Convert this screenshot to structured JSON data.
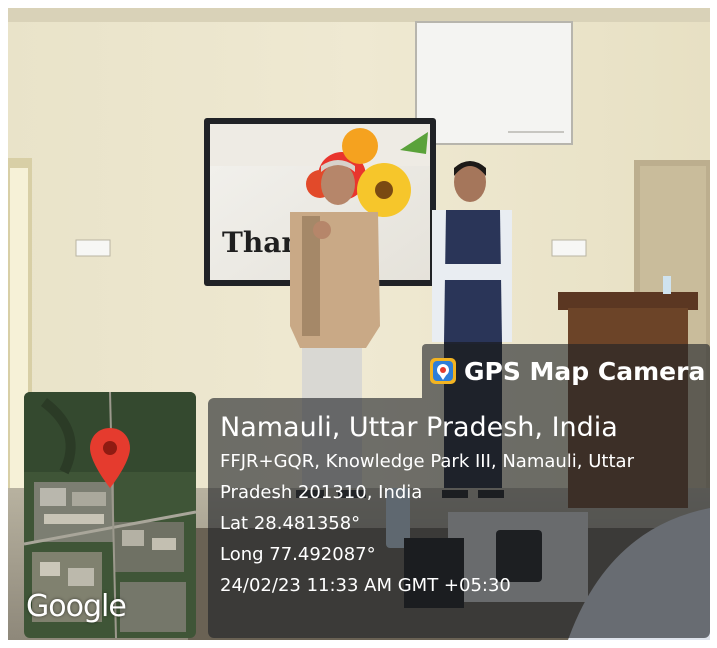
{
  "screen": {
    "text": "Thank"
  },
  "overlay": {
    "app_name": "GPS Map Camera",
    "icon": "gps-map-camera-app-icon",
    "location_title": "Namauli, Uttar Pradesh, India",
    "address_line1": "FFJR+GQR, Knowledge Park III, Namauli, Uttar",
    "address_line2": "Pradesh 201310, India",
    "lat": "Lat 28.481358°",
    "long": "Long 77.492087°",
    "timestamp": "24/02/23 11:33 AM GMT +05:30",
    "map_logo": "Google",
    "pin_color": "#e53b2e",
    "overlay_color": "#1e2226"
  }
}
